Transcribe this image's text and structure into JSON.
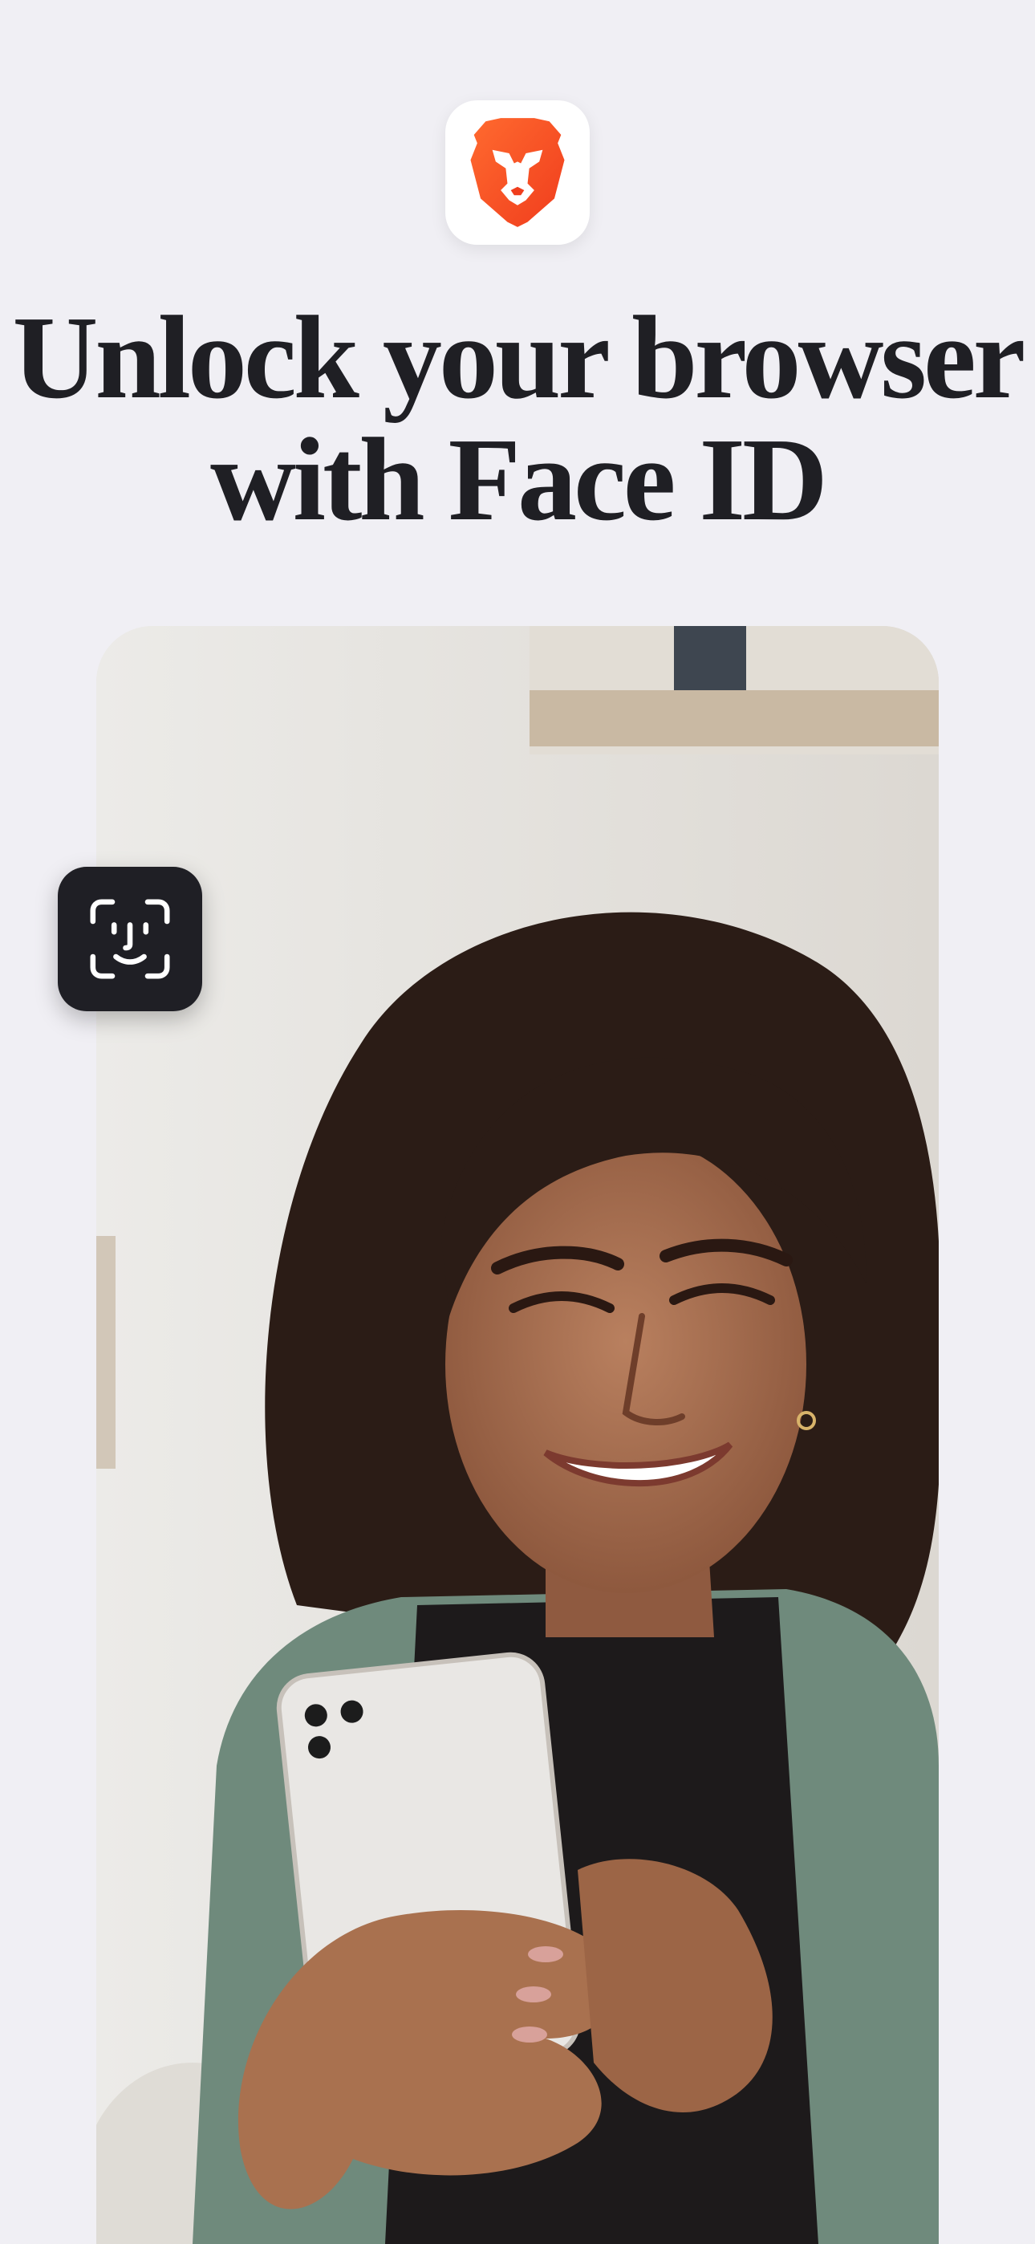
{
  "app": {
    "icon": "brave-lion-icon",
    "brand_color": "#fb542b"
  },
  "headline": {
    "line1": "Unlock your browser",
    "line2": "with Face ID"
  },
  "photo": {
    "icon": "person-using-phone-photo"
  },
  "face_id": {
    "icon": "face-id-icon"
  }
}
